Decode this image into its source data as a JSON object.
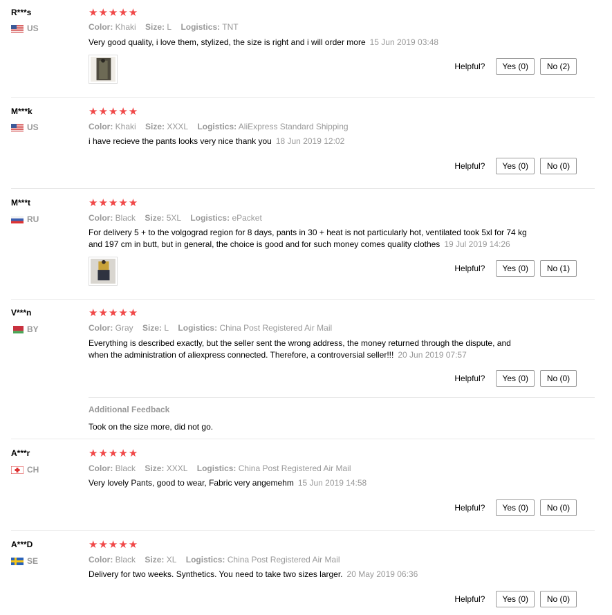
{
  "labels": {
    "color": "Color:",
    "size": "Size:",
    "logistics": "Logistics:",
    "helpful": "Helpful?",
    "additional_feedback": "Additional Feedback"
  },
  "rating_stars": "★★★★★",
  "reviews": [
    {
      "user": "R***s",
      "country": "US",
      "flag": "us-flag-icon",
      "rating": 5,
      "color": "Khaki",
      "size": "L",
      "logistics": "TNT",
      "text": "Very good quality, i love them, stylized, the size is right and i will order more",
      "date": "15 Jun 2019 03:48",
      "has_photo": true,
      "yes": "Yes (0)",
      "no": "No (2)"
    },
    {
      "user": "M***k",
      "country": "US",
      "flag": "us-flag-icon",
      "rating": 5,
      "color": "Khaki",
      "size": "XXXL",
      "logistics": "AliExpress Standard Shipping",
      "text": "i have recieve the pants looks very nice thank you",
      "date": "18 Jun 2019 12:02",
      "has_photo": false,
      "yes": "Yes (0)",
      "no": "No (0)"
    },
    {
      "user": "M***t",
      "country": "RU",
      "flag": "ru-flag-icon",
      "rating": 5,
      "color": "Black",
      "size": "5XL",
      "logistics": "ePacket",
      "text": "For delivery 5 + to the volgograd region for 8 days, pants in 30 + heat is not particularly hot, ventilated took 5xl for 74 kg and 197 cm in butt, but in general, the choice is good and for such money comes quality clothes",
      "date": "19 Jul 2019 14:26",
      "has_photo": true,
      "yes": "Yes (0)",
      "no": "No (1)"
    },
    {
      "user": "V***n",
      "country": "BY",
      "flag": "by-flag-icon",
      "rating": 5,
      "color": "Gray",
      "size": "L",
      "logistics": "China Post Registered Air Mail",
      "text": "Everything is described exactly, but the seller sent the wrong address, the money returned through the dispute, and when the administration of aliexpress connected. Therefore, a controversial seller!!!",
      "date": "20 Jun 2019 07:57",
      "has_photo": false,
      "yes": "Yes (0)",
      "no": "No (0)",
      "additional": "Took on the size more, did not go."
    },
    {
      "user": "A***r",
      "country": "CH",
      "flag": "ch-flag-icon",
      "rating": 5,
      "color": "Black",
      "size": "XXXL",
      "logistics": "China Post Registered Air Mail",
      "text": "Very lovely Pants, good to wear, Fabric very angemehm",
      "date": "15 Jun 2019 14:58",
      "has_photo": false,
      "yes": "Yes (0)",
      "no": "No (0)"
    },
    {
      "user": "A***D",
      "country": "SE",
      "flag": "se-flag-icon",
      "rating": 5,
      "color": "Black",
      "size": "XL",
      "logistics": "China Post Registered Air Mail",
      "text": "Delivery for two weeks. Synthetics. You need to take two sizes larger.",
      "date": "20 May 2019 06:36",
      "has_photo": false,
      "yes": "Yes (0)",
      "no": "No (0)"
    }
  ]
}
